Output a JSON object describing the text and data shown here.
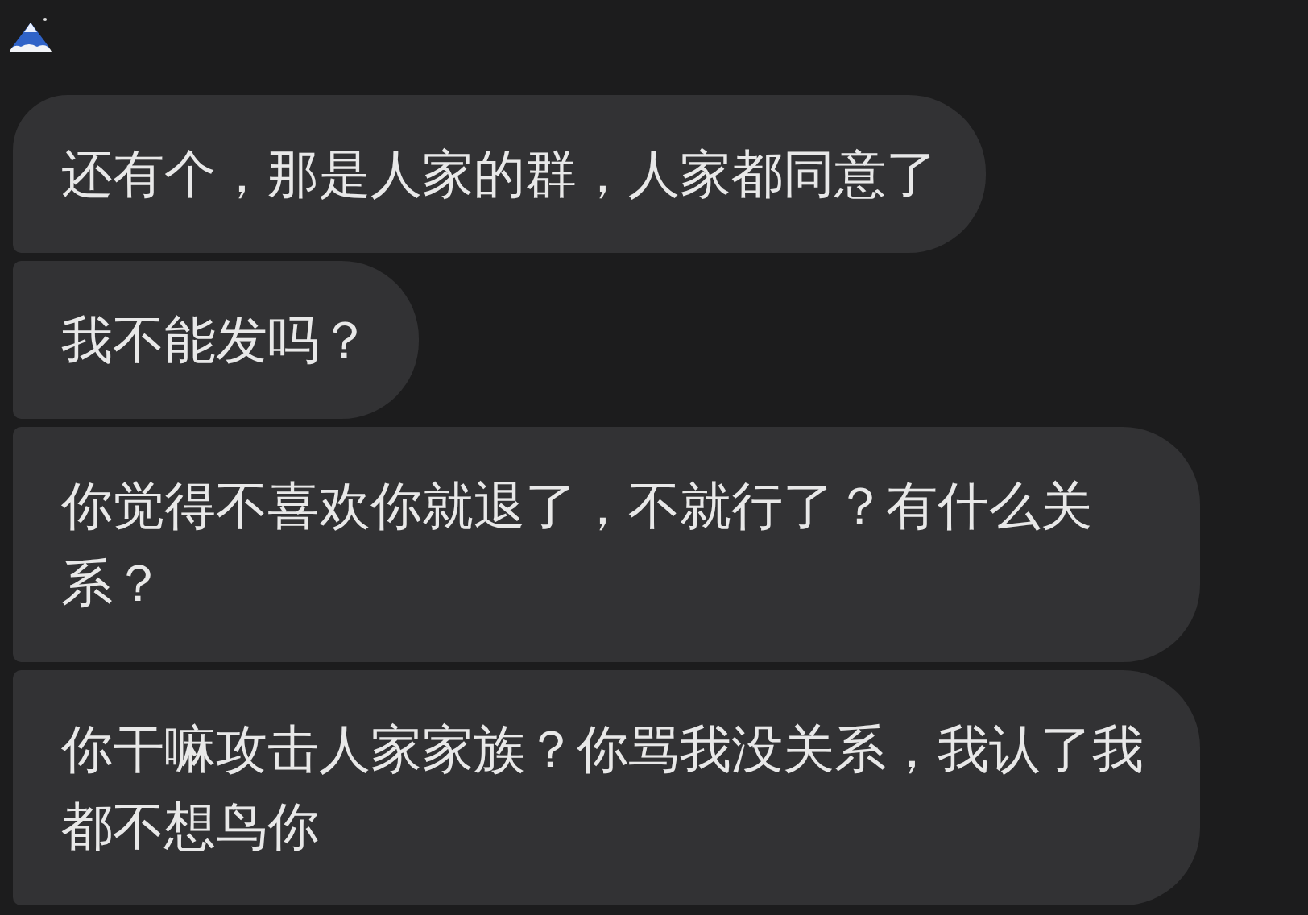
{
  "messages": [
    {
      "text": "还有个，那是人家的群，人家都同意了"
    },
    {
      "text": "我不能发吗？"
    },
    {
      "text": "你觉得不喜欢你就退了，不就行了？有什么关系？"
    },
    {
      "text": "你干嘛攻击人家家族？你骂我没关系，我认了我都不想鸟你"
    }
  ]
}
